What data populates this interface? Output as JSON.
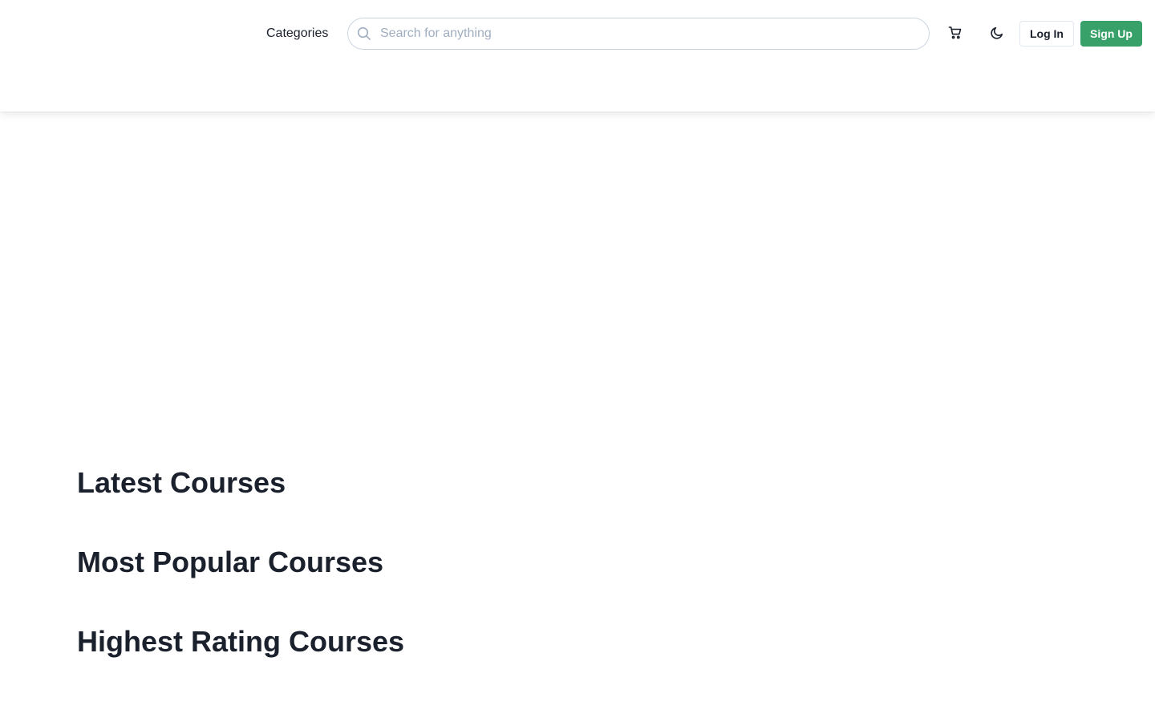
{
  "header": {
    "categories_label": "Categories",
    "search": {
      "placeholder": "Search for anything",
      "value": "",
      "icon": "search-icon"
    },
    "cart_icon": "cart-icon",
    "theme_toggle_icon": "moon-icon",
    "login_label": "Log In",
    "signup_label": "Sign Up"
  },
  "sections": [
    {
      "title": "Latest Courses"
    },
    {
      "title": "Most Popular Courses"
    },
    {
      "title": "Highest Rating Courses"
    }
  ],
  "colors": {
    "accent": "#38a169",
    "text": "#1a202c",
    "placeholder": "#a0aec0",
    "border": "#cbd5e0"
  }
}
